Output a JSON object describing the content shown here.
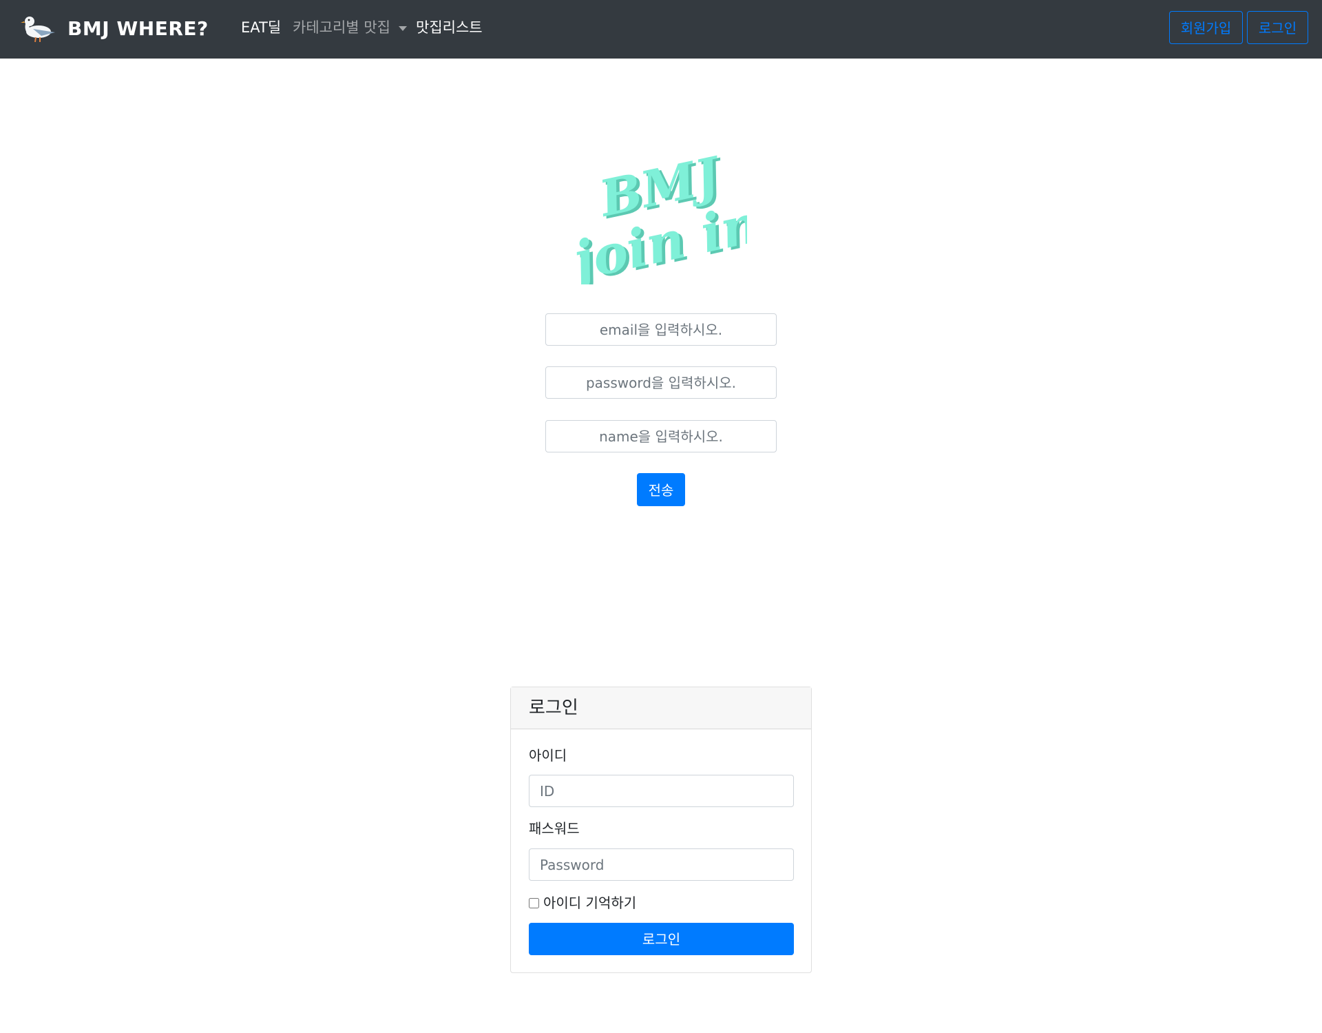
{
  "navbar": {
    "brand": "BMJ WHERE?",
    "brand_icon": "seagull-icon",
    "links": {
      "eat_deal": "EAT딜",
      "category": "카테고리별 맛집",
      "list": "맛집리스트"
    },
    "signup": "회원가입",
    "login": "로그인"
  },
  "join_logo": {
    "line1": "BMJ",
    "line2": "join in",
    "color": "#7ff0d8"
  },
  "signup_form": {
    "email_placeholder": "email을 입력하시오.",
    "password_placeholder": "password을 입력하시오.",
    "name_placeholder": "name을 입력하시오.",
    "submit": "전송"
  },
  "login_card": {
    "title": "로그인",
    "id_label": "아이디",
    "id_placeholder": "ID",
    "password_label": "패스워드",
    "password_placeholder": "Password",
    "remember_label": "아이디 기억하기",
    "login_button": "로그인"
  },
  "colors": {
    "navbar_bg": "#343a40",
    "primary": "#007bff",
    "logo_mint": "#7ff0d8"
  }
}
